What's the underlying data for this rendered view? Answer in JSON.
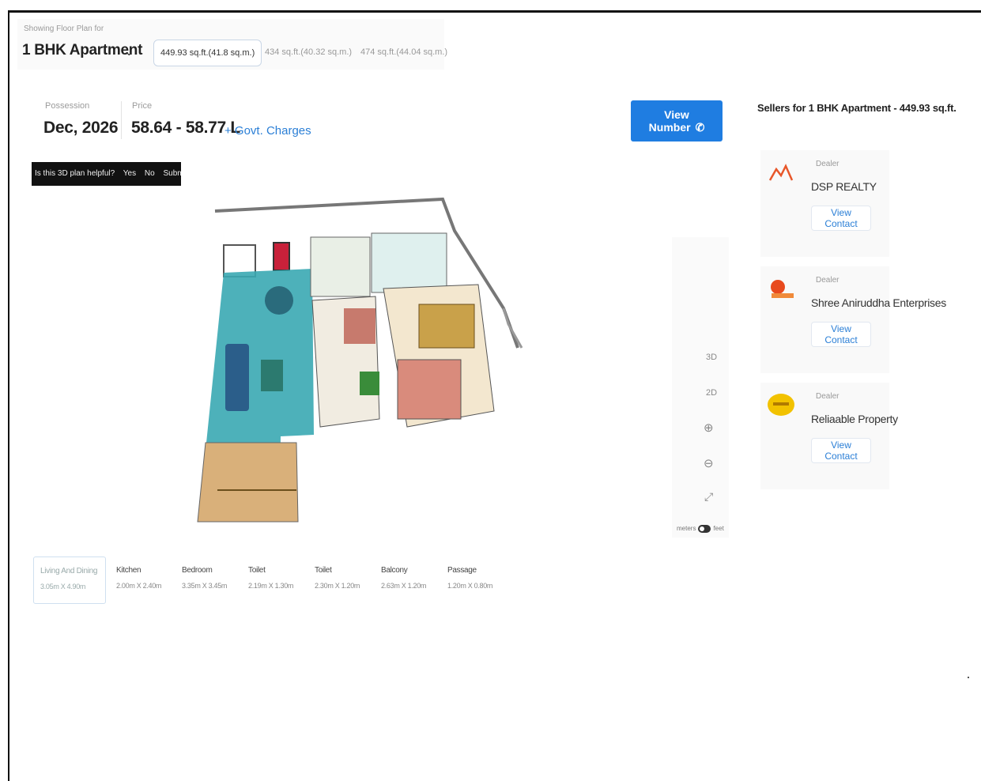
{
  "header": {
    "showing_label": "Showing Floor Plan for",
    "unit_type": "1 BHK Apartment",
    "size_tabs": [
      {
        "label": "449.93 sq.ft.(41.8 sq.m.)",
        "active": true
      },
      {
        "label": "434 sq.ft.(40.32 sq.m.)",
        "active": false
      },
      {
        "label": "474 sq.ft.(44.04 sq.m.)",
        "active": false
      }
    ]
  },
  "info": {
    "possession_label": "Possession",
    "possession_value": "Dec, 2026",
    "price_label": "Price",
    "price_value": "58.64 - 58.77 L",
    "govt_charges": "+ Govt. Charges"
  },
  "view_number_label": "View Number",
  "feedback": {
    "question": "Is this 3D plan helpful?",
    "yes": "Yes",
    "no": "No",
    "submit": "Submit"
  },
  "controls": {
    "mode_3d": "3D",
    "mode_2d": "2D",
    "toggle_left": "meters",
    "toggle_right": "feet"
  },
  "sellers": {
    "title": "Sellers for 1 BHK Apartment - 449.93 sq.ft.",
    "items": [
      {
        "type": "Dealer",
        "name": "DSP REALTY",
        "cta": "View Contact",
        "logo_color": "#e8572a"
      },
      {
        "type": "Dealer",
        "name": "Shree Aniruddha Enterprises",
        "cta": "View Contact",
        "logo_color": "#e84a1e"
      },
      {
        "type": "Dealer",
        "name": "Reliaable Property",
        "cta": "View Contact",
        "logo_color": "#f2c200"
      }
    ]
  },
  "rooms": [
    {
      "name": "Living And Dining",
      "dim": "3.05m X 4.90m",
      "active": true
    },
    {
      "name": "Kitchen",
      "dim": "2.00m X 2.40m",
      "active": false
    },
    {
      "name": "Bedroom",
      "dim": "3.35m X 3.45m",
      "active": false
    },
    {
      "name": "Toilet",
      "dim": "2.19m X 1.30m",
      "active": false
    },
    {
      "name": "Toilet",
      "dim": "2.30m X 1.20m",
      "active": false
    },
    {
      "name": "Balcony",
      "dim": "2.63m X 1.20m",
      "active": false
    },
    {
      "name": "Passage",
      "dim": "1.20m X 0.80m",
      "active": false
    }
  ],
  "colors": {
    "accent": "#1f7de1",
    "link": "#2b7fd6",
    "living_floor": "#3aa9b3",
    "bed": "#d98b7c",
    "wall": "#777777"
  }
}
